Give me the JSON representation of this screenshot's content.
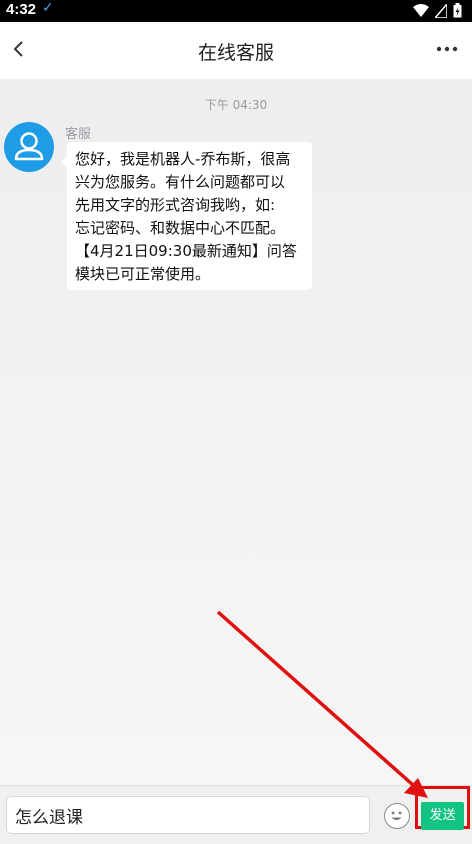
{
  "status_bar": {
    "time": "4:32"
  },
  "nav": {
    "title": "在线客服"
  },
  "chat": {
    "timestamp": "下午 04:30",
    "messages": [
      {
        "sender": "客服",
        "lines": [
          "您好，我是机器人-乔布斯，很高",
          "兴为您服务。有什么问题都可以",
          "先用文字的形式咨询我哟，如:",
          "忘记密码、和数据中心不匹配。",
          "【4月21日09:30最新通知】问答",
          "模块已可正常使用。"
        ]
      }
    ]
  },
  "input": {
    "value": "怎么退课"
  },
  "actions": {
    "send_label": "发送"
  },
  "colors": {
    "send": "#13c383",
    "avatar": "#1e9de6",
    "annotation": "#e01010"
  }
}
